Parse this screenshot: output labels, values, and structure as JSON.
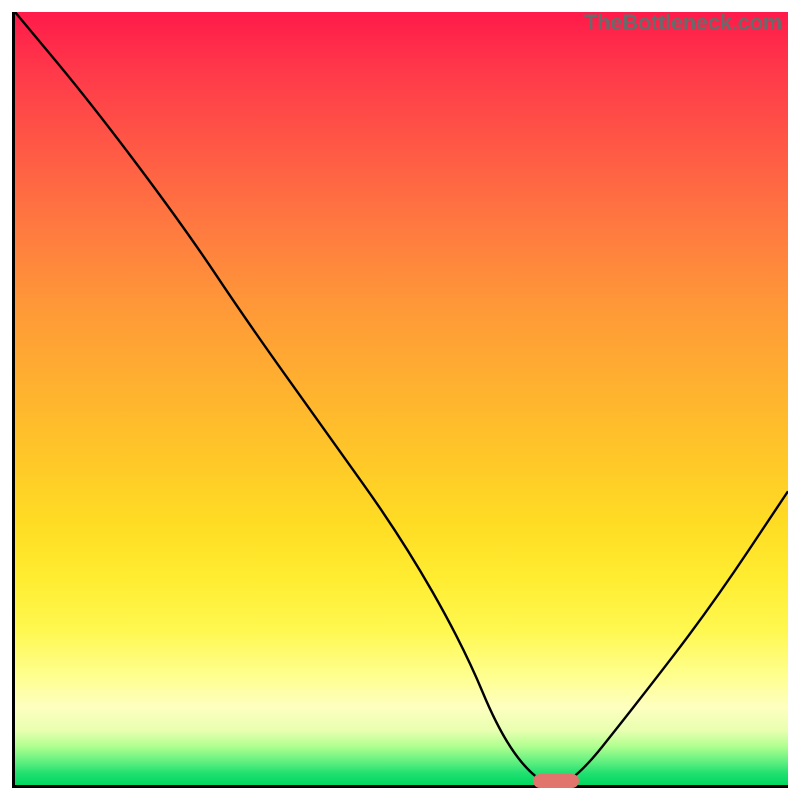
{
  "watermark": "TheBottleneck.com",
  "chart_data": {
    "type": "line",
    "title": "",
    "xlabel": "",
    "ylabel": "",
    "x": [
      0,
      10,
      22,
      30,
      40,
      50,
      58,
      63,
      68,
      72,
      80,
      90,
      100
    ],
    "values": [
      100,
      88,
      72,
      60,
      46,
      32,
      18,
      6,
      0,
      0,
      10,
      23,
      38
    ],
    "xlim": [
      0,
      100
    ],
    "ylim": [
      0,
      100
    ],
    "legend": false,
    "grid": false,
    "gradient_background": {
      "top_color": "#ff1a4a",
      "mid_color": "#ffdc24",
      "bottom_color": "#00d860"
    },
    "marker": {
      "x_center": 70,
      "y": 0,
      "width_pct": 6,
      "color": "#e2746e"
    }
  }
}
